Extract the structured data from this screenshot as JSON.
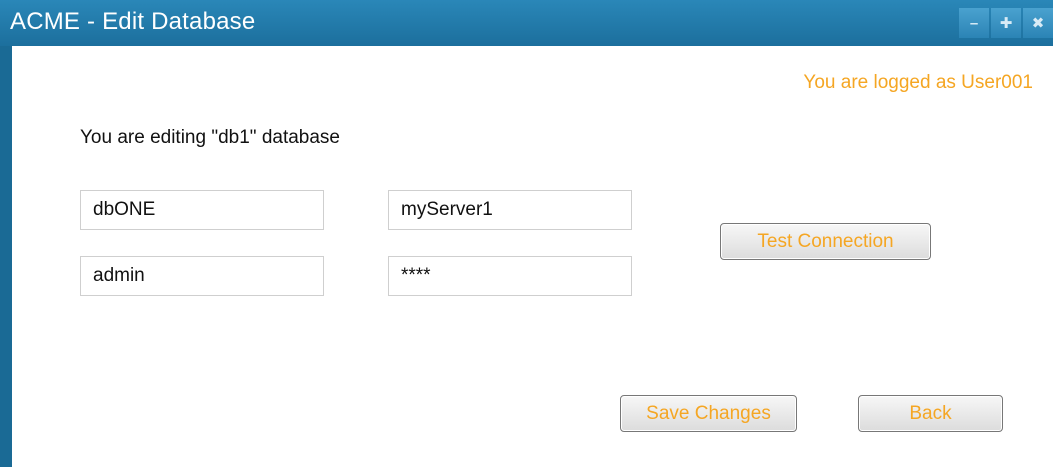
{
  "window": {
    "title": "ACME - Edit Database",
    "controls": {
      "minimize": "–",
      "maximize": "✚",
      "close": "✖"
    }
  },
  "header": {
    "logged_in_text": "You are logged as User001"
  },
  "main": {
    "editing_text": "You are editing \"db1\" database",
    "fields": {
      "db_name": "dbONE",
      "server": "myServer1",
      "username": "admin",
      "password": "****"
    },
    "buttons": {
      "test_connection": "Test Connection",
      "save_changes": "Save Changes",
      "back": "Back"
    }
  },
  "colors": {
    "titlebar": "#1c6f9d",
    "accent_text": "#f5a623"
  }
}
